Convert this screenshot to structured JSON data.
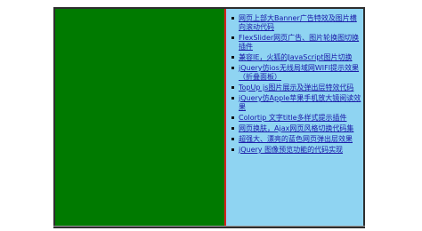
{
  "left_list": {
    "items": []
  },
  "right_list": {
    "items": [
      "网页上部大Banner广告特效及图片横向滚动代码",
      "FlexSlider网页广告、图片轮换图切换插件",
      "兼容IE，火狐的JavaScript图片切换",
      "jQuery仿ios无线局域网WIFI提示效果（折叠面板）",
      "TopUp js图片展示及弹出层特效代码",
      "jQuery仿Apple苹果手机放大镜阅读效果",
      "Colortip 文字title多样式提示插件",
      "网页换肤，Ajax网页风格切换代码集",
      "超强大、漂亮的蓝色网页弹出层效果",
      "jQuery 图像预览功能的代码实现"
    ]
  },
  "colors": {
    "left_panel": "#007a00",
    "right_panel": "#8fd4f2",
    "divider": "#d62020",
    "link": "#1a1aa8"
  }
}
